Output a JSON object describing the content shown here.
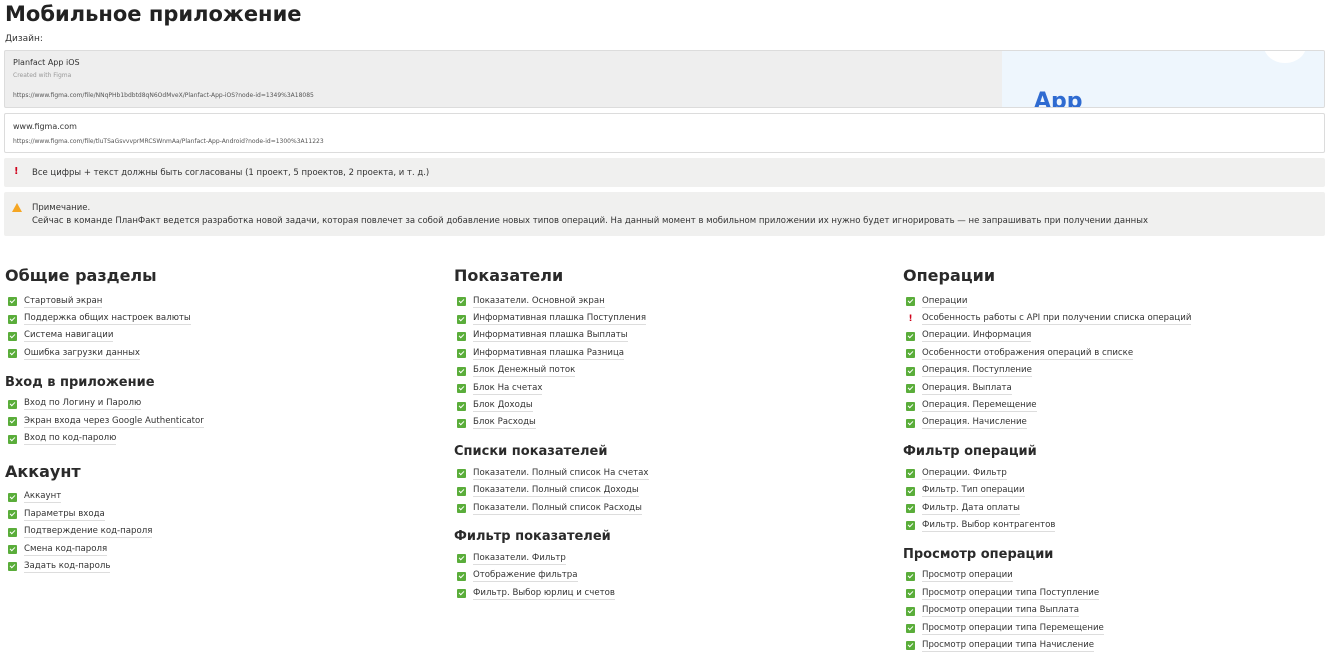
{
  "page_title": "Мобильное приложение",
  "design_label": "Дизайн:",
  "figma_ios": {
    "title": "Planfact App iOS",
    "subtitle": "Created with Figma",
    "url": "https://www.figma.com/file/NNqPHb1bdbtd8qN6OdMveX/Planfact-App-iOS?node-id=1349%3A18085",
    "thumb_text": "App"
  },
  "figma_android": {
    "title": "www.figma.com",
    "url": "https://www.figma.com/file/tluTSaGsvvvprMRCSWnmAa/Planfact-App-Android?node-id=1300%3A11223"
  },
  "warning": {
    "icon": "exclamation-icon",
    "text": "Все цифры + текст должны быть согласованы (1 проект, 5 проектов, 2 проекта, и т. д.)"
  },
  "note": {
    "icon": "warning-triangle-icon",
    "heading": "Примечание.",
    "text": "Сейчас в команде ПланФакт ведется разработка новой задачи, которая повлечет за собой добавление новых типов операций. На данный момент в мобильном приложении их нужно будет игнорировать — не запрашивать при получении данных"
  },
  "columns": [
    [
      {
        "title": "Общие разделы",
        "level": 2,
        "items": [
          {
            "label": "Стартовый экран",
            "status": "done"
          },
          {
            "label": "Поддержка общих настроек валюты",
            "status": "done"
          },
          {
            "label": "Система навигации",
            "status": "done"
          },
          {
            "label": "Ошибка загрузки данных",
            "status": "done"
          }
        ]
      },
      {
        "title": "Вход в приложение",
        "level": 3,
        "items": [
          {
            "label": "Вход по Логину и Паролю",
            "status": "done"
          },
          {
            "label": "Экран входа через Google Authenticator",
            "status": "done"
          },
          {
            "label": "Вход по код-паролю",
            "status": "done"
          }
        ]
      },
      {
        "title": "Аккаунт",
        "level": 2,
        "items": [
          {
            "label": "Аккаунт",
            "status": "done"
          },
          {
            "label": "Параметры входа",
            "status": "done"
          },
          {
            "label": "Подтверждение код-пароля",
            "status": "done"
          },
          {
            "label": "Смена код-пароля",
            "status": "done"
          },
          {
            "label": "Задать код-пароль",
            "status": "done"
          }
        ]
      }
    ],
    [
      {
        "title": "Показатели",
        "level": 2,
        "items": [
          {
            "label": "Показатели. Основной экран",
            "status": "done"
          },
          {
            "label": "Информативная плашка Поступления",
            "status": "done"
          },
          {
            "label": "Информативная плашка Выплаты",
            "status": "done"
          },
          {
            "label": "Информативная плашка Разница",
            "status": "done"
          },
          {
            "label": "Блок Денежный поток",
            "status": "done"
          },
          {
            "label": "Блок На счетах",
            "status": "done"
          },
          {
            "label": "Блок Доходы",
            "status": "done"
          },
          {
            "label": "Блок Расходы",
            "status": "done"
          }
        ]
      },
      {
        "title": "Списки показателей",
        "level": 3,
        "items": [
          {
            "label": "Показатели. Полный список На счетах",
            "status": "done"
          },
          {
            "label": "Показатели. Полный список Доходы",
            "status": "done"
          },
          {
            "label": "Показатели. Полный список Расходы",
            "status": "done"
          }
        ]
      },
      {
        "title": "Фильтр показателей",
        "level": 3,
        "items": [
          {
            "label": "Показатели. Фильтр",
            "status": "done"
          },
          {
            "label": "Отображение фильтра",
            "status": "done"
          },
          {
            "label": "Фильтр. Выбор юрлиц и счетов",
            "status": "done"
          }
        ]
      }
    ],
    [
      {
        "title": "Операции",
        "level": 2,
        "items": [
          {
            "label": "Операции",
            "status": "done"
          },
          {
            "label": "Особенность работы с API при получении списка операций",
            "status": "warning"
          },
          {
            "label": "Операции. Информация",
            "status": "done"
          },
          {
            "label": "Особенности отображения операций в списке",
            "status": "done"
          },
          {
            "label": "Операция. Поступление",
            "status": "done"
          },
          {
            "label": "Операция. Выплата",
            "status": "done"
          },
          {
            "label": "Операция. Перемещение",
            "status": "done"
          },
          {
            "label": "Операция. Начисление",
            "status": "done"
          }
        ]
      },
      {
        "title": "Фильтр операций",
        "level": 3,
        "items": [
          {
            "label": "Операции. Фильтр",
            "status": "done"
          },
          {
            "label": "Фильтр. Тип операции",
            "status": "done"
          },
          {
            "label": "Фильтр. Дата оплаты",
            "status": "done"
          },
          {
            "label": "Фильтр. Выбор контрагентов",
            "status": "done"
          }
        ]
      },
      {
        "title": "Просмотр операции",
        "level": 3,
        "items": [
          {
            "label": "Просмотр операции",
            "status": "done"
          },
          {
            "label": "Просмотр операции типа Поступление",
            "status": "done"
          },
          {
            "label": "Просмотр операции типа Выплата",
            "status": "done"
          },
          {
            "label": "Просмотр операции типа Перемещение",
            "status": "done"
          },
          {
            "label": "Просмотр операции типа Начисление",
            "status": "done"
          }
        ]
      }
    ]
  ]
}
